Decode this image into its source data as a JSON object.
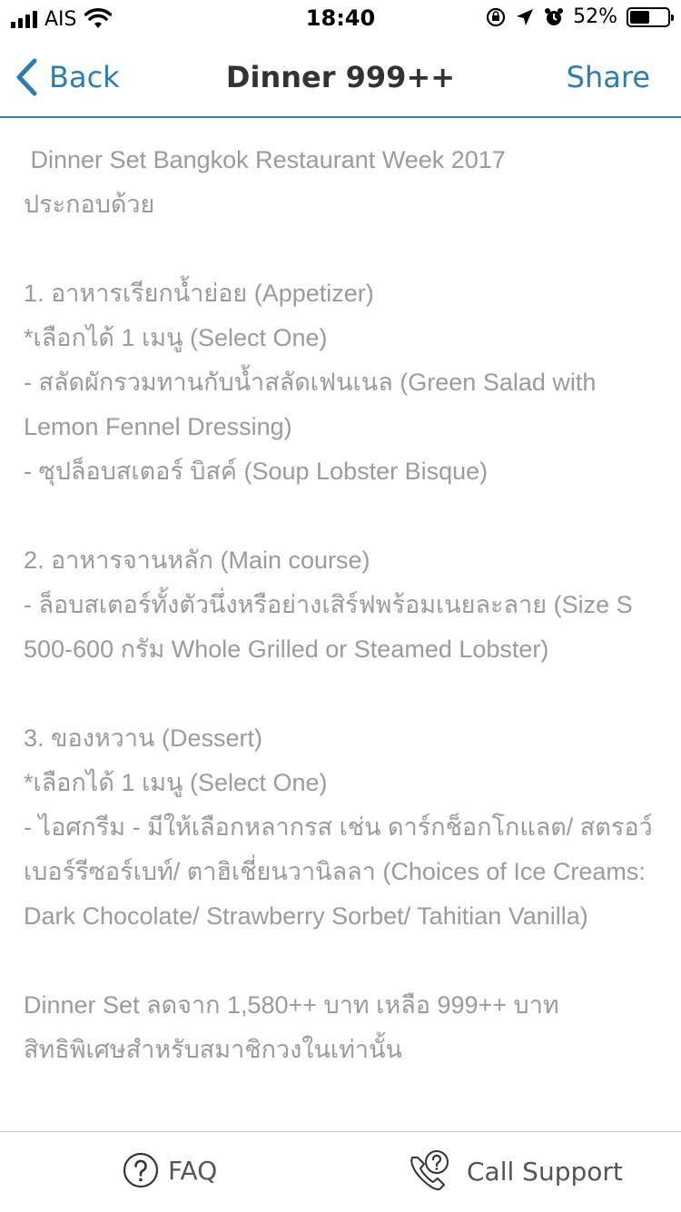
{
  "status_bar": {
    "carrier": "AIS",
    "time": "18:40",
    "battery_percent": "52%",
    "battery_level": 0.52
  },
  "nav": {
    "back_label": "Back",
    "title": "Dinner 999++",
    "share_label": "Share",
    "accent_color": "#2d7eab"
  },
  "content": {
    "intro_line1": " Dinner Set Bangkok Restaurant Week 2017",
    "intro_line2": "ประกอบด้วย",
    "section1": {
      "heading": "1. อาหารเรียกน้ำย่อย (Appetizer)",
      "note": "*เลือกได้ 1 เมนู (Select One)",
      "item1": "- สลัดผักรวมทานกับน้ำสลัดเฟนเนล (Green Salad with Lemon Fennel Dressing)",
      "item2": "- ซุปล็อบสเตอร์ บิสค์ (Soup Lobster Bisque)"
    },
    "section2": {
      "heading": "2. อาหารจานหลัก (Main course)",
      "item1": "- ล็อบสเตอร์ทั้งตัวนึ่งหรือย่างเสิร์ฟพร้อมเนยละลาย (Size S 500-600 กรัม Whole Grilled or Steamed Lobster)"
    },
    "section3": {
      "heading": "3. ของหวาน (Dessert)",
      "note": "*เลือกได้ 1 เมนู (Select One)",
      "item1": "- ไอศกรีม - มีให้เลือกหลากรส เช่น ดาร์กช็อกโกแลต/ สตรอว์เบอร์รีซอร์เบท์/ ตาฮิเชี่ยนวานิลลา (Choices of Ice Creams: Dark Chocolate/ Strawberry Sorbet/ Tahitian Vanilla)"
    },
    "price_line": "Dinner Set ลดจาก 1,580++ บาท เหลือ 999++ บาท",
    "member_line": "สิทธิพิเศษสำหรับสมาชิกวงในเท่านั้น"
  },
  "bottom_bar": {
    "faq_label": "FAQ",
    "call_support_label": "Call Support",
    "faq_icon": "question-circle-icon",
    "call_icon": "phone-question-icon"
  }
}
